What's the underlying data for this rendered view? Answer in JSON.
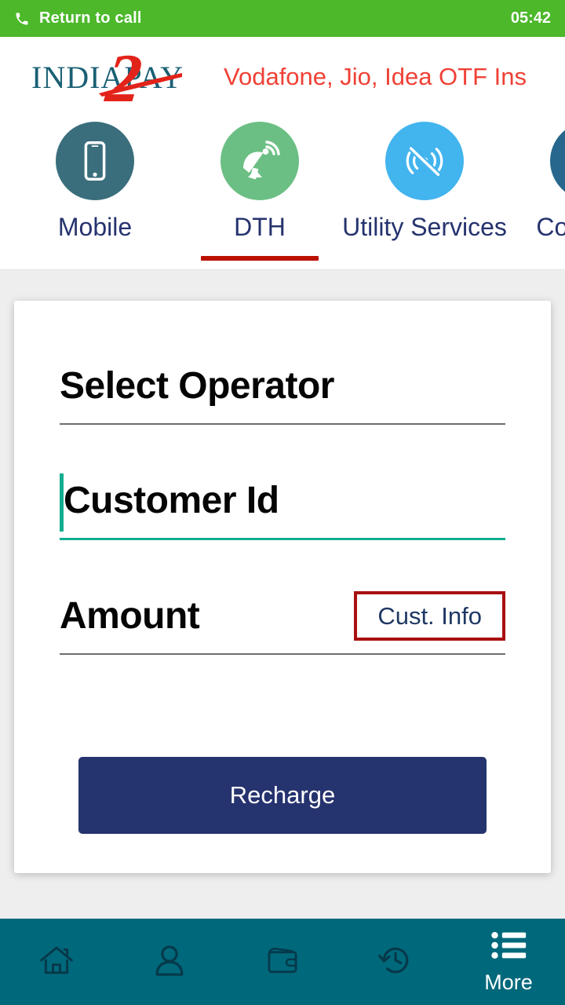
{
  "statusbar": {
    "phone_icon": "phone-icon",
    "call_label": "Return to call",
    "timer": "05:42",
    "bg_color": "#4cb82a"
  },
  "header": {
    "logo": {
      "text_left": "INDIA",
      "text_right": "PAY",
      "accent_char": "2",
      "color": "#1a6074",
      "accent_color": "#e2231a"
    },
    "marquee": {
      "text": "Vodafone, Jio, Idea OTF Ins",
      "color": "#ef4136"
    }
  },
  "tabs": {
    "active_index": 1,
    "active_underline_color": "#bb1100",
    "items": [
      {
        "label": "Mobile",
        "icon": "mobile-phone-icon",
        "circle_color": "#3b6e7c"
      },
      {
        "label": "DTH",
        "icon": "satellite-dish-icon",
        "circle_color": "#6cbf84"
      },
      {
        "label": "Utility Services",
        "icon": "signal-off-icon",
        "circle_color": "#42b4ee"
      },
      {
        "label": "Complain",
        "icon": "complaint-person-icon",
        "circle_color": "#27678d"
      }
    ]
  },
  "form": {
    "operator_field": {
      "label": "Select Operator",
      "placeholder": "Select Operator",
      "value": "",
      "focused": false
    },
    "customer_field": {
      "label": "Customer Id",
      "placeholder": "Customer Id",
      "value": "",
      "focused": true,
      "focus_color": "#13ad8f"
    },
    "amount_field": {
      "label": "Amount",
      "placeholder": "Amount",
      "value": "",
      "focused": false
    },
    "cust_info_button": {
      "label": "Cust. Info",
      "border_color": "#a81010",
      "text_color": "#1f3864"
    },
    "recharge_button": {
      "label": "Recharge",
      "bg_color": "#25336e",
      "text_color": "#ffffff"
    }
  },
  "bottomnav": {
    "bg_color": "#00687b",
    "active_index": 4,
    "items": [
      {
        "label": "",
        "icon": "home-icon"
      },
      {
        "label": "",
        "icon": "person-icon"
      },
      {
        "label": "",
        "icon": "wallet-icon"
      },
      {
        "label": "",
        "icon": "history-icon"
      },
      {
        "label": "More",
        "icon": "list-menu-icon"
      }
    ]
  }
}
